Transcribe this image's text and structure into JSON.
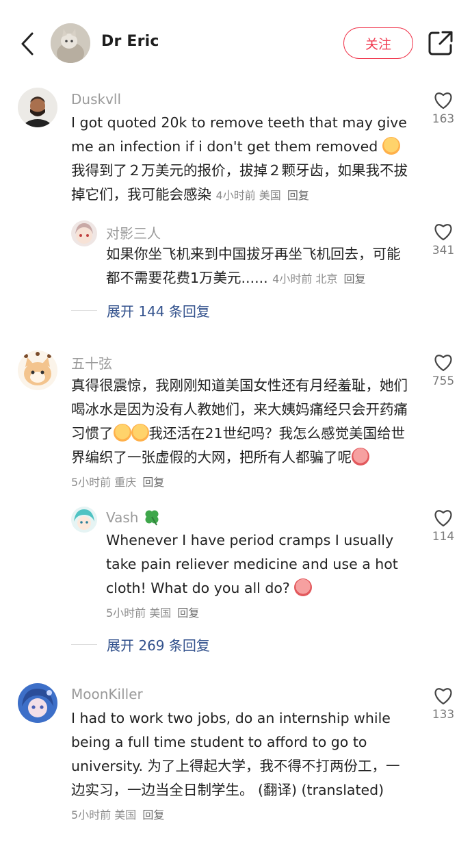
{
  "header": {
    "back_icon": "chevron-left-icon",
    "name": "Dr Eric",
    "follow_label": "关注",
    "share_icon": "share-external-icon",
    "accent": "#f0384e"
  },
  "comments": [
    {
      "username": "Duskvll",
      "text_before": "I got quoted 20k to remove teeth that may give me an infection if i don't get them removed ",
      "emoji1": "crying-emoji",
      "text_after": "我得到了２万美元的报价，拔掉２颗牙齿，如果我不拔掉它们，我可能会感染",
      "meta": "4小时前 美国",
      "reply_label": "回复",
      "likes": "163",
      "replies": [
        {
          "username": "对影三人",
          "text": "如果你坐飞机来到中国拔牙再坐飞机回去，可能都不需要花费1万美元......",
          "meta": "4小时前 北京",
          "reply_label": "回复",
          "likes": "341"
        }
      ],
      "expand_label": "展开 144 条回复"
    },
    {
      "username": "五十弦",
      "text_part1": "真得很震惊，我刚刚知道美国女性还有月经羞耻，她们喝冰水是因为没有人教她们，来大姨妈痛经只会开药痛习惯了",
      "text_part2": "我还活在21世纪吗？我怎么感觉美国给世界编织了一张虚假的大网，把所有人都骗了呢",
      "meta": "5小时前 重庆",
      "reply_label": "回复",
      "likes": "755",
      "replies": [
        {
          "username": "Vash",
          "username_icon": "clover-icon",
          "text": "Whenever I have period cramps I usually take pain reliever medicine and use a hot cloth! What do you all do? ",
          "meta": "5小时前 美国",
          "reply_label": "回复",
          "likes": "114"
        }
      ],
      "expand_label": "展开 269 条回复"
    },
    {
      "username": "MoonKiller",
      "text": "I had to work two jobs, do an internship while being a full time student to afford to go to university. 为了上得起大学，我不得不打两份工，一边实习，一边当全日制学生。 (翻译) (translated)",
      "meta": "5小时前 美国",
      "reply_label": "回复",
      "likes": "133"
    }
  ]
}
